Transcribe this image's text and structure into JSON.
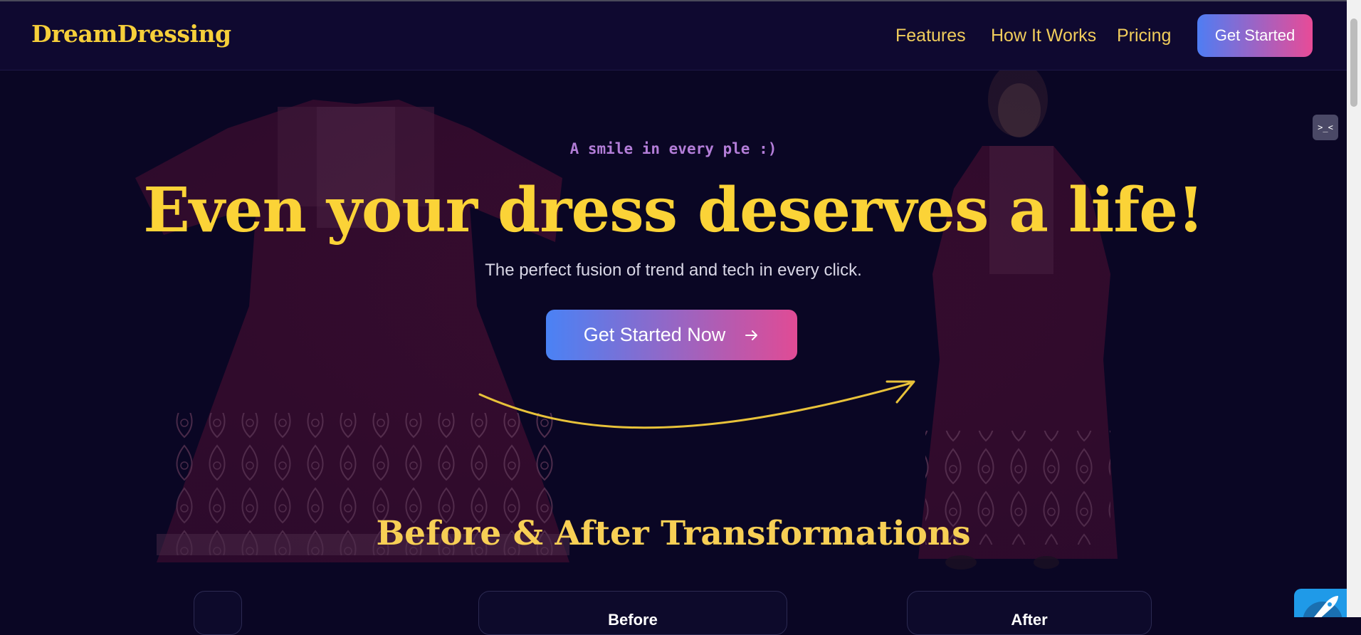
{
  "nav": {
    "logo": "DreamDressing",
    "links": [
      "Features",
      "How It Works",
      "Pricing"
    ],
    "cta": "Get Started"
  },
  "hero": {
    "tagline": "A smile in every ple :)",
    "headline": "Even your dress deserves a life!",
    "subtitle": "The perfect fusion of trend and tech in every click.",
    "cta": "Get Started Now",
    "cta_icon": "arrow-right-icon"
  },
  "section": {
    "title": "Before & After Transformations",
    "cards": [
      "Before",
      "After"
    ]
  },
  "widgets": {
    "dev_toggle": ">_<",
    "rocket_icon": "rocket-icon"
  },
  "colors": {
    "background": "#0a0624",
    "accent_yellow": "#fbd337",
    "gradient_start": "#4a82f5",
    "gradient_end": "#e04b95",
    "dress": "#7a1540"
  }
}
